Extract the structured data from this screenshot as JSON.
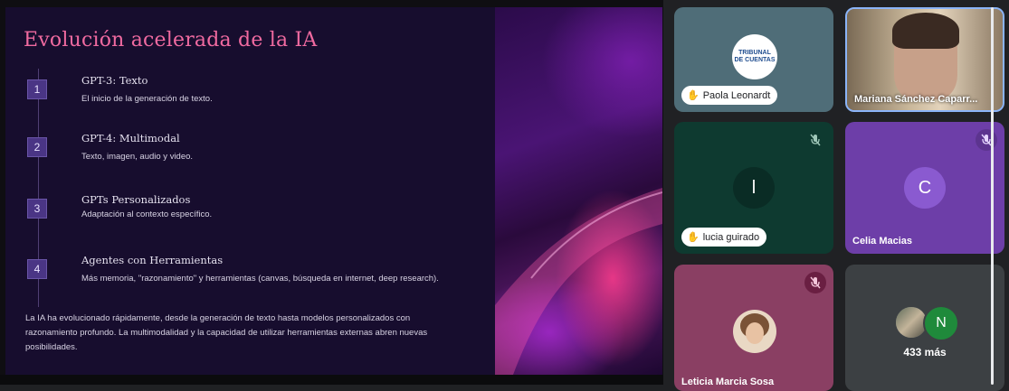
{
  "slide": {
    "title": "Evolución acelerada de la IA",
    "steps": [
      {
        "num": "1",
        "title": "GPT-3: Texto",
        "desc": "El inicio de la generación de texto."
      },
      {
        "num": "2",
        "title": "GPT-4: Multimodal",
        "desc": "Texto, imagen, audio y video."
      },
      {
        "num": "3",
        "title": "GPTs Personalizados",
        "desc": "Adaptación al contexto específico."
      },
      {
        "num": "4",
        "title": "Agentes con Herramientas",
        "desc": "Más memoria, \"razonamiento\" y herramientas (canvas, búsqueda en internet, deep research)."
      }
    ],
    "summary": "La IA ha evolucionado rápidamente, desde la generación de texto hasta modelos personalizados con razonamiento profundo. La multimodalidad y la capacidad de utilizar herramientas externas abren nuevas posibilidades."
  },
  "participants": {
    "paola": {
      "name": "Paola Leonardt",
      "logo_line1": "TRIBUNAL",
      "logo_line2": "DE CUENTAS"
    },
    "mariana": {
      "name": "Mariana Sánchez Caparr..."
    },
    "lucia": {
      "name": "lucia guirado",
      "initial": "l"
    },
    "celia": {
      "name": "Celia Macias",
      "initial": "C"
    },
    "leticia": {
      "name": "Leticia Marcia Sosa"
    },
    "more": {
      "label": "433 más",
      "initial": "N"
    }
  },
  "colors": {
    "title_pink": "#f06aa0",
    "slide_bg": "#170d2e",
    "step_badge": "#4a3585",
    "tile_teal": "#4f6d78",
    "tile_green": "#0e3a30",
    "tile_purple": "#6d3ea8",
    "tile_rose": "#8a3f63",
    "tile_gray": "#3c4043",
    "avatar_green": "#1f8a3b"
  },
  "icons": {
    "hand": "raised-hand-icon",
    "muted": "mic-off-icon"
  }
}
